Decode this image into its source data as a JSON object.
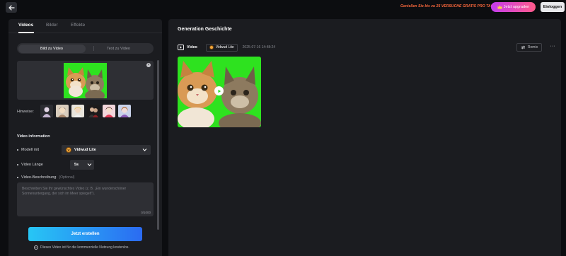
{
  "topbar": {
    "promo_text": "Genießen Sie bis zu 25 VERSUCHE GRATIS PRO TAG!",
    "upgrade_label": "Jetzt upgraden",
    "login_label": "Einloggen",
    "accent_color": "#ff6a3d"
  },
  "left_panel": {
    "tabs": [
      {
        "label": "Videos",
        "active": true
      },
      {
        "label": "Bilder",
        "active": false
      },
      {
        "label": "Effekte",
        "active": false
      }
    ],
    "mode": {
      "options": [
        "Bild zu Video",
        "Text zu Video"
      ],
      "selected": "Bild zu Video"
    },
    "hints_label": "Hinweise:",
    "section_title": "Video information",
    "model_label": "Modell mit",
    "model_value": "Vidwud Lite",
    "length_label": "Video Länge",
    "length_value": "5s",
    "description_label": "Video-Beschreibung",
    "description_optional": "(Optional)",
    "description_placeholder": "Beschreiben Sie Ihr gewünschtes Video (z. B. „Ein wunderschöner Sonnenuntergang, der sich im Meer spiegelt\").",
    "char_counter": "0/1000",
    "create_label": "Jetzt erstellen",
    "footer_note": "Dieses Video ist für die kommerzielle Nutzung kostenlos."
  },
  "right_panel": {
    "title": "Generation Geschichte",
    "item": {
      "type_label": "Video",
      "model_chip": "Vidwud Lite",
      "timestamp": "2025-07-16 14:48:24",
      "remix_label": "Remix"
    }
  },
  "colors": {
    "green_screen": "#2ee21f",
    "button_gradient_start": "#27c6f5",
    "button_gradient_end": "#2b6bf2",
    "upgrade_gradient_start": "#c33cf0",
    "upgrade_gradient_end": "#ff5b8a"
  }
}
